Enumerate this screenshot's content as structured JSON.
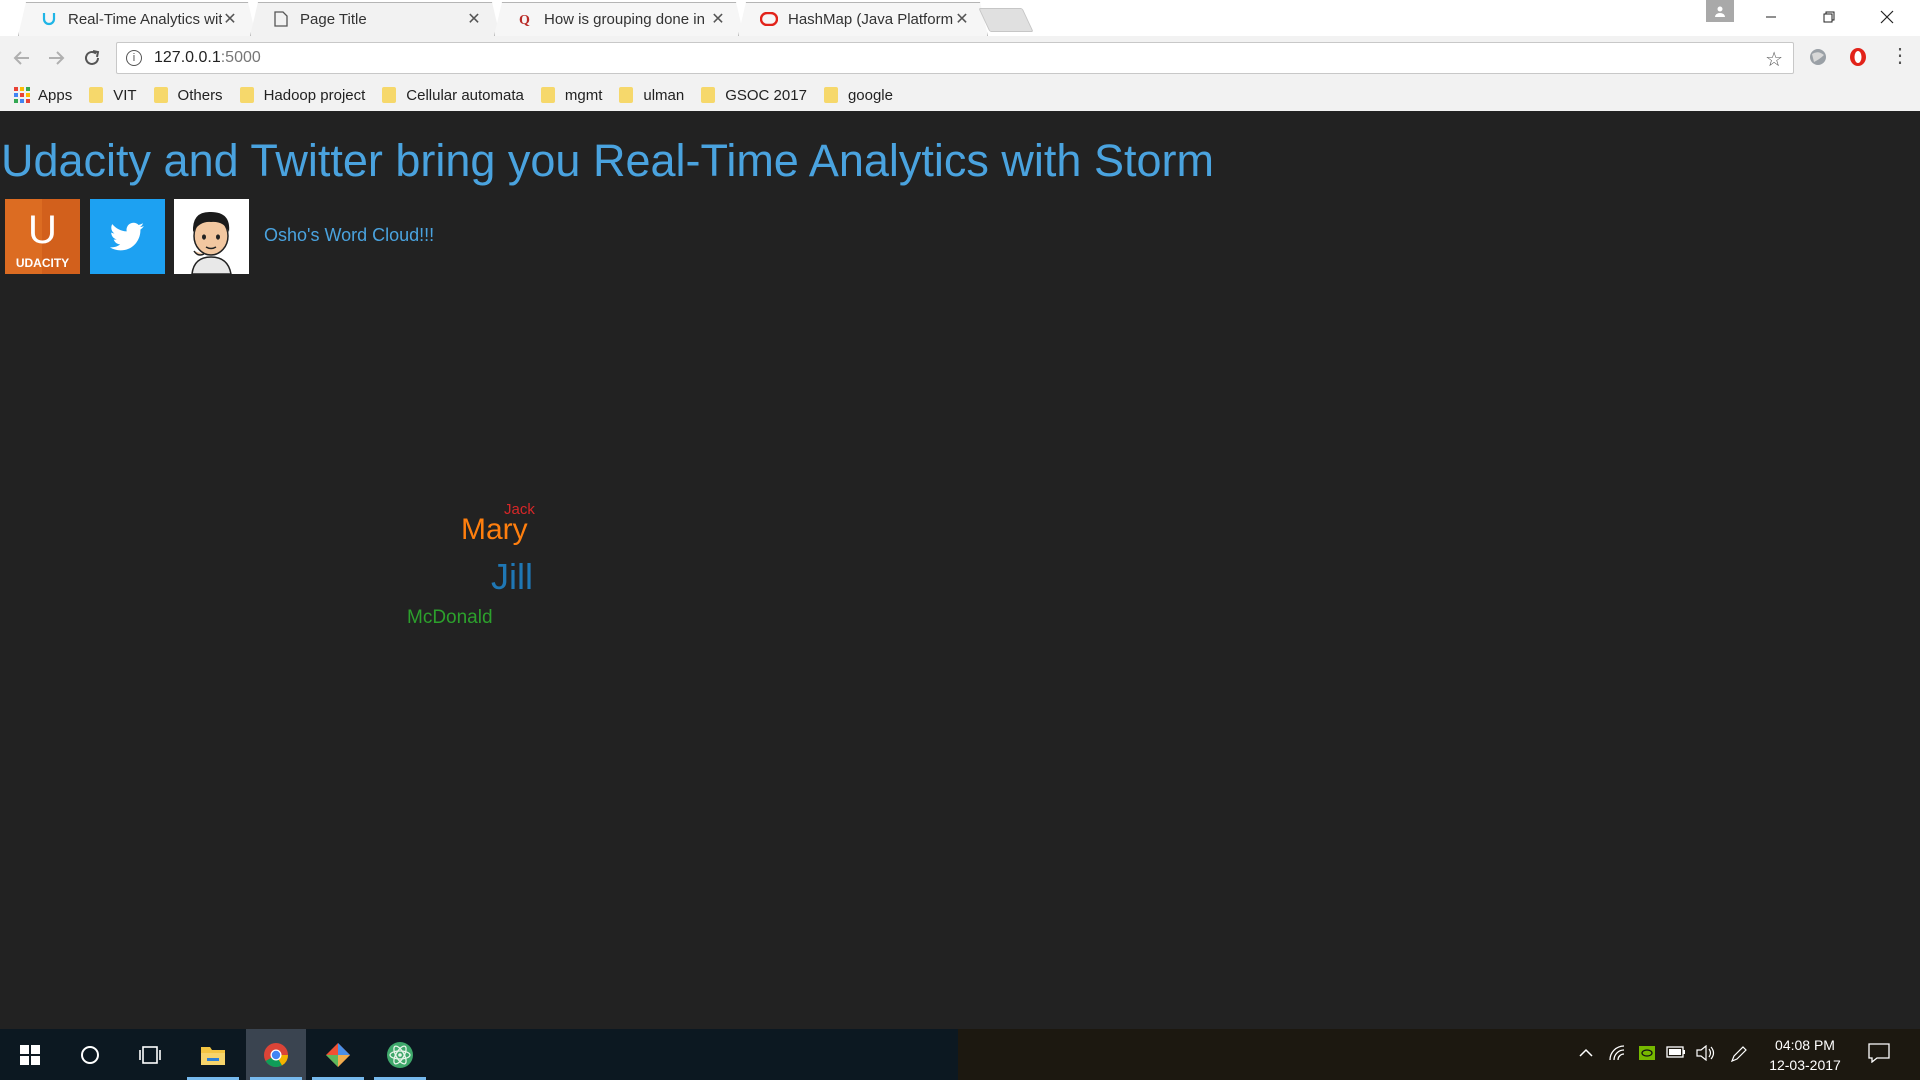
{
  "browser": {
    "tabs": [
      {
        "title": "Real-Time Analytics with",
        "favicon": "udacity-favicon-icon",
        "active": false
      },
      {
        "title": "Page Title",
        "favicon": "page-icon",
        "active": true
      },
      {
        "title": "How is grouping done in",
        "favicon": "quora-favicon-icon",
        "active": false
      },
      {
        "title": "HashMap (Java Platform",
        "favicon": "oracle-favicon-icon",
        "active": false
      }
    ],
    "close_glyph": "✕",
    "address": {
      "host": "127.0.0.1",
      "port": ":5000"
    },
    "bookmarks": [
      {
        "label": "Apps",
        "icon": "apps-grid-icon"
      },
      {
        "label": "VIT",
        "icon": "folder-icon"
      },
      {
        "label": "Others",
        "icon": "folder-icon"
      },
      {
        "label": "Hadoop project",
        "icon": "folder-icon"
      },
      {
        "label": "Cellular automata",
        "icon": "folder-icon"
      },
      {
        "label": "mgmt",
        "icon": "folder-icon"
      },
      {
        "label": "ulman",
        "icon": "folder-icon"
      },
      {
        "label": "GSOC 2017",
        "icon": "folder-icon"
      },
      {
        "label": "google",
        "icon": "folder-icon"
      }
    ]
  },
  "page": {
    "heading": "Udacity and Twitter bring you Real-Time Analytics with Storm",
    "logos": {
      "udacity_text": "UDACITY",
      "udacity_mark": "U"
    },
    "link": "Osho's Word Cloud!!!",
    "word_cloud": [
      {
        "word": "Jack",
        "color": "#d62728"
      },
      {
        "word": "Mary",
        "color": "#ff7f0e"
      },
      {
        "word": "Jill",
        "color": "#1f77b4"
      },
      {
        "word": "McDonald",
        "color": "#2ca02c"
      }
    ]
  },
  "taskbar": {
    "time": "04:08 PM",
    "date": "12-03-2017"
  },
  "colors": {
    "link_blue": "#4aa3df",
    "page_bg": "#222222",
    "twitter_blue": "#1da1f2",
    "udacity_orange": "#e06a1c"
  }
}
